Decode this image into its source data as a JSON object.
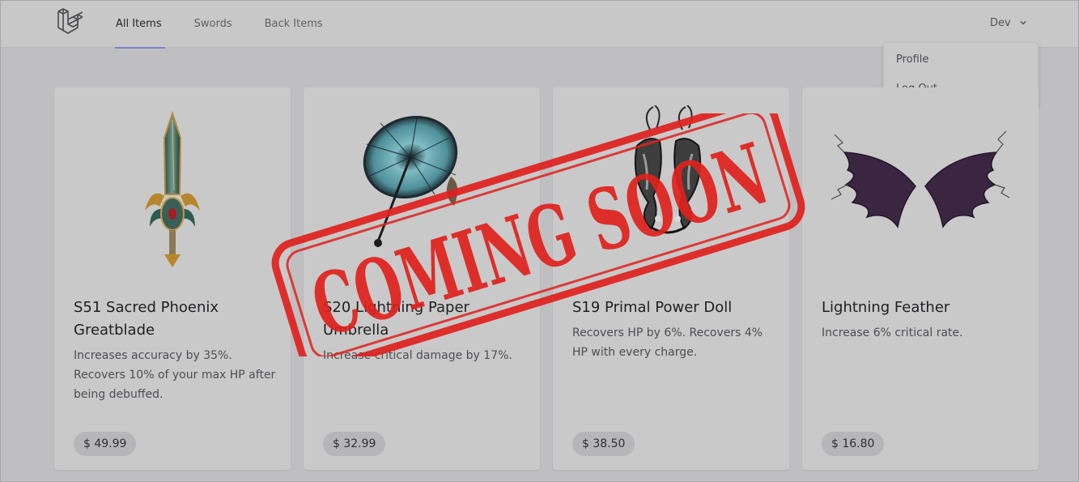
{
  "nav": {
    "links": [
      {
        "label": "All Items",
        "active": true
      },
      {
        "label": "Swords",
        "active": false
      },
      {
        "label": "Back Items",
        "active": false
      }
    ],
    "user": "Dev",
    "menu": [
      "Profile",
      "Log Out"
    ]
  },
  "items": [
    {
      "title": "S51 Sacred Phoenix Greatblade",
      "description": "Increases accuracy by 35%. Recovers 10% of your max HP after being debuffed.",
      "price": "$ 49.99",
      "icon": "greatblade-icon"
    },
    {
      "title": "S20 Lightning Paper Umbrella",
      "description": "Increase critical damage by 17%.",
      "price": "$ 32.99",
      "icon": "umbrella-icon"
    },
    {
      "title": "S19 Primal Power Doll",
      "description": "Recovers HP by 6%. Recovers 4% HP with every charge.",
      "price": "$ 38.50",
      "icon": "power-doll-icon"
    },
    {
      "title": "Lightning Feather",
      "description": "Increase 6% critical rate.",
      "price": "$ 16.80",
      "icon": "feather-wings-icon"
    }
  ],
  "overlay": {
    "text": "COMING SOON",
    "color": "#e0211d"
  },
  "colors": {
    "accent": "#7e80cf",
    "background": "#bfbfc1"
  }
}
